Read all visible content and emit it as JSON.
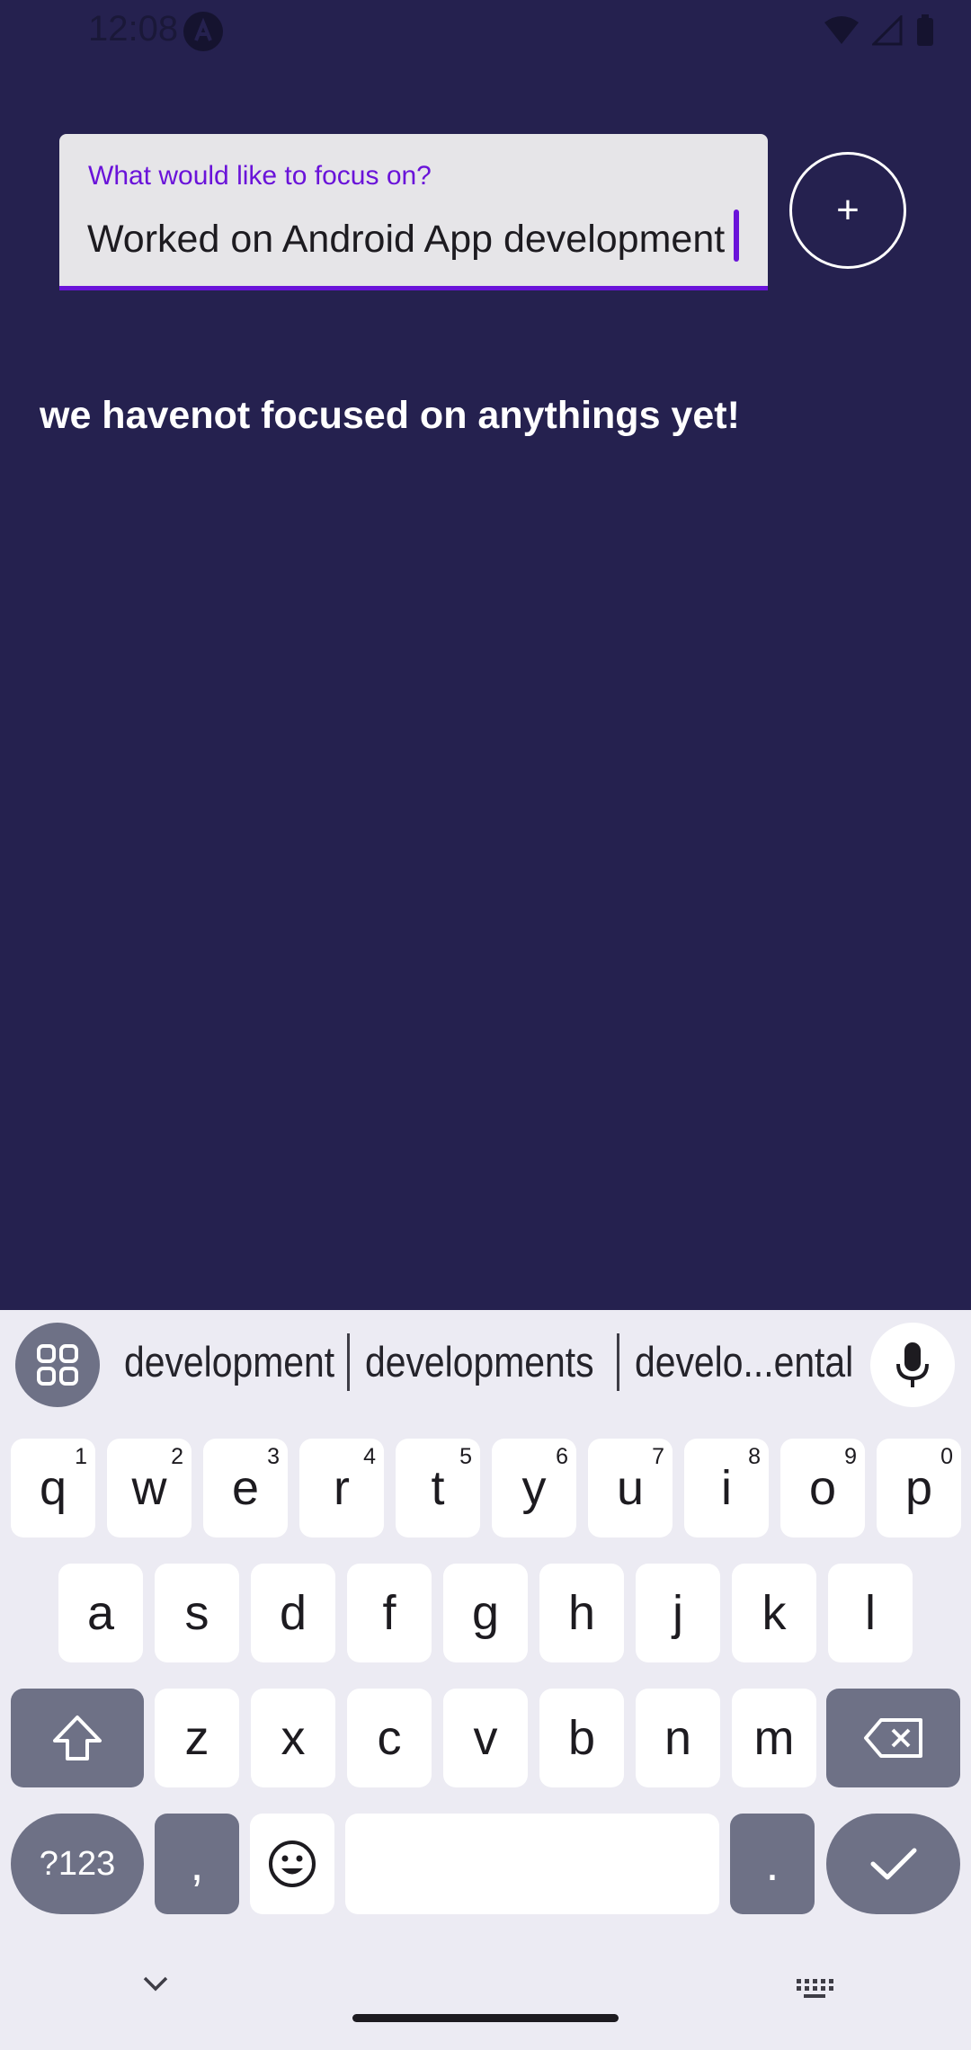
{
  "status_bar": {
    "time": "12:08"
  },
  "input": {
    "label": "What would like to focus on?",
    "value": "Worked on Android App development"
  },
  "add_button": {
    "label": "+"
  },
  "empty_message": "we havenot focused on anythings yet!",
  "keyboard": {
    "suggestions": [
      "development",
      "developments",
      "develo...ental"
    ],
    "rows": [
      [
        {
          "k": "q",
          "h": "1"
        },
        {
          "k": "w",
          "h": "2"
        },
        {
          "k": "e",
          "h": "3"
        },
        {
          "k": "r",
          "h": "4"
        },
        {
          "k": "t",
          "h": "5"
        },
        {
          "k": "y",
          "h": "6"
        },
        {
          "k": "u",
          "h": "7"
        },
        {
          "k": "i",
          "h": "8"
        },
        {
          "k": "o",
          "h": "9"
        },
        {
          "k": "p",
          "h": "0"
        }
      ],
      [
        {
          "k": "a"
        },
        {
          "k": "s"
        },
        {
          "k": "d"
        },
        {
          "k": "f"
        },
        {
          "k": "g"
        },
        {
          "k": "h"
        },
        {
          "k": "j"
        },
        {
          "k": "k"
        },
        {
          "k": "l"
        }
      ],
      [
        {
          "k": "z"
        },
        {
          "k": "x"
        },
        {
          "k": "c"
        },
        {
          "k": "v"
        },
        {
          "k": "b"
        },
        {
          "k": "n"
        },
        {
          "k": "m"
        }
      ]
    ],
    "symbols_label": "?123",
    "comma": ",",
    "period": ".",
    "icons": {
      "grid": "apps-grid-icon",
      "mic": "microphone-icon",
      "shift": "shift-arrow-icon",
      "backspace": "backspace-icon",
      "emoji": "emoji-icon",
      "enter": "checkmark-icon"
    }
  },
  "colors": {
    "background": "#25214f",
    "accent": "#6a13d9",
    "key_dark": "#6e7186"
  }
}
